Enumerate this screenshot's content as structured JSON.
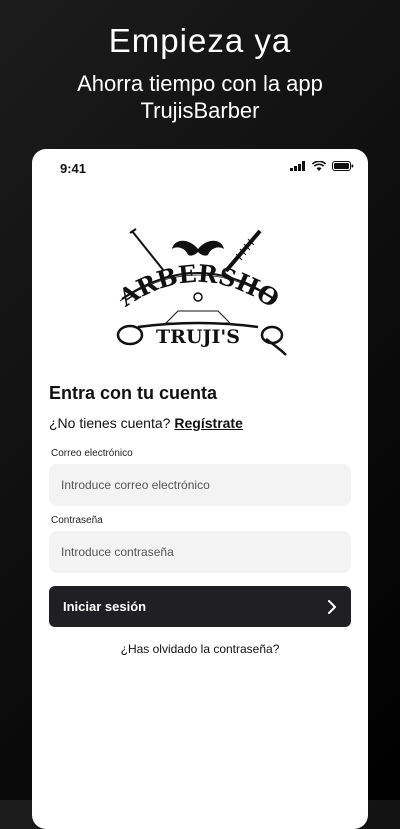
{
  "hero": {
    "title": "Empieza ya",
    "subtitle_line1": "Ahorra tiempo con la app",
    "subtitle_line2": "TrujisBarber"
  },
  "status_bar": {
    "time": "9:41",
    "icons": [
      "signal-icon",
      "wifi-icon",
      "battery-icon"
    ]
  },
  "logo": {
    "brand_top": "BARBERSHOP",
    "brand_bottom": "TRUJI'S"
  },
  "login": {
    "heading": "Entra con tu cuenta",
    "no_account_text": "¿No tienes cuenta?",
    "signup_link": "Regístrate",
    "email_label": "Correo electrónico",
    "email_placeholder": "Introduce correo electrónico",
    "email_value": "",
    "password_label": "Contraseña",
    "password_placeholder": "Introduce contraseña",
    "password_value": "",
    "submit_label": "Iniciar sesión",
    "submit_icon": "chevron-right-icon",
    "forgot_password": "¿Has olvidado la contraseña?"
  },
  "colors": {
    "button_bg": "#1f1f24",
    "input_bg": "#f3f3f3",
    "background": "#111111"
  }
}
